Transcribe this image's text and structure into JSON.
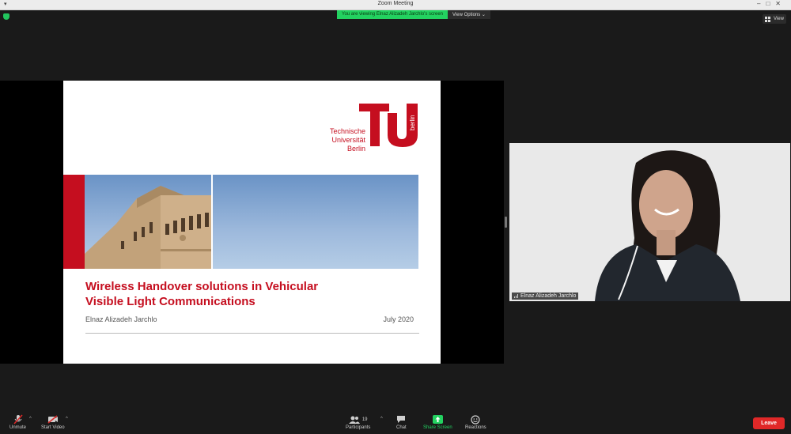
{
  "window": {
    "title": "Zoom Meeting",
    "menu_glyph": "▾",
    "controls": "–□✕"
  },
  "banner": {
    "viewing_text": "You are viewing Elnaz Alizadeh Jarchlo's screen",
    "view_options_label": "View Options ⌄"
  },
  "top_right": {
    "view_label": "View"
  },
  "slide": {
    "logo_lines": [
      "Technische",
      "Universität",
      "Berlin"
    ],
    "logo_vertical": "berlin",
    "title_line1": "Wireless Handover solutions in Vehicular",
    "title_line2": "Visible Light Communications",
    "author": "Elnaz Alizadeh Jarchlo",
    "date": "July 2020"
  },
  "participant": {
    "name": "Elnaz Alizadeh Jarchlo"
  },
  "toolbar": {
    "unmute_label": "Unmute",
    "start_video_label": "Start Video",
    "participants_label": "Participants",
    "participants_count": "19",
    "chat_label": "Chat",
    "share_screen_label": "Share Screen",
    "reactions_label": "Reactions",
    "leave_label": "Leave",
    "caret_glyph": "^"
  },
  "colors": {
    "tu_red": "#c50e1f",
    "banner_green": "#23d160",
    "leave_red": "#e02828"
  }
}
